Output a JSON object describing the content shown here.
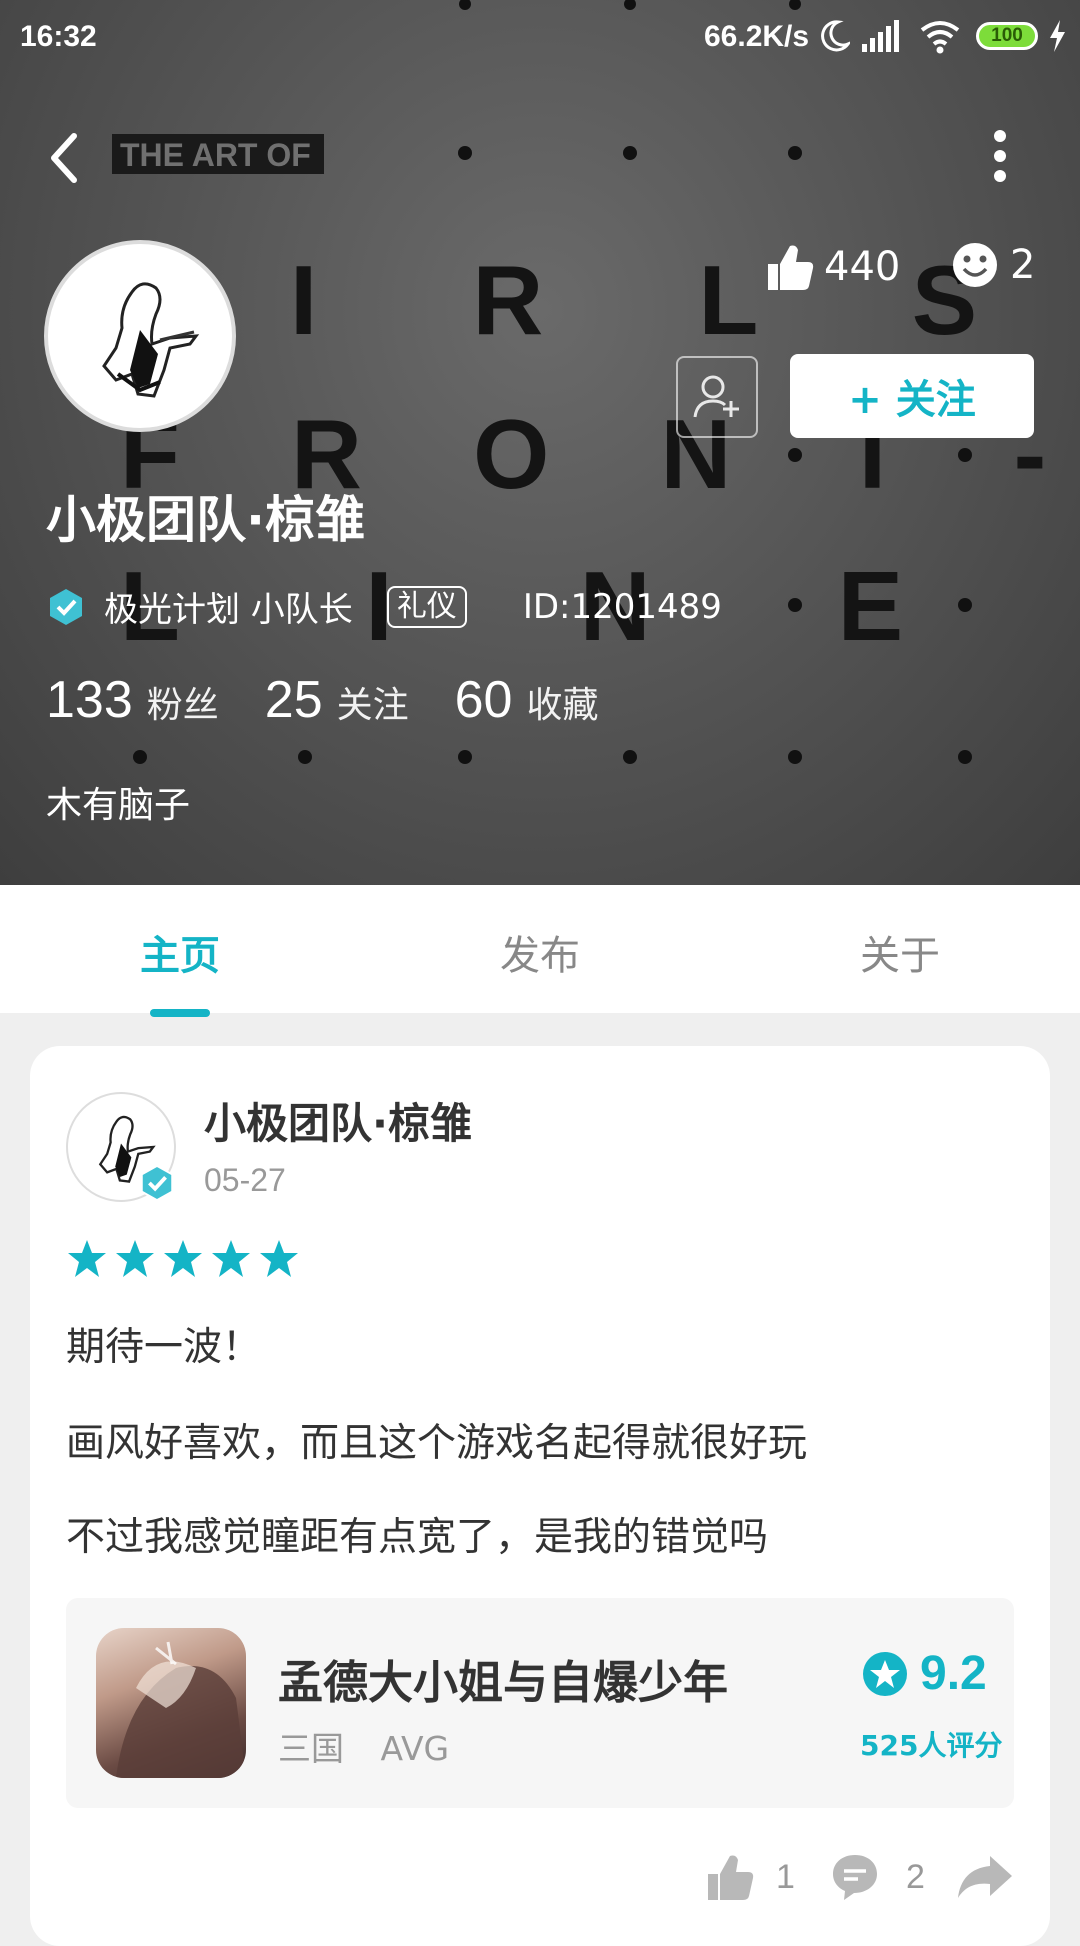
{
  "status_bar": {
    "time": "16:32",
    "net_speed": "66.2K/s",
    "battery": "100"
  },
  "header": {
    "likes": "440",
    "smiles": "2",
    "follow_label": "+ 关注",
    "name": "小极团队·椋雏",
    "badge_title": "极光计划 小队长",
    "etiquette_tag": "礼仪",
    "user_id": "ID:1201489",
    "stats": [
      {
        "value": "133",
        "label": "粉丝"
      },
      {
        "value": "25",
        "label": "关注"
      },
      {
        "value": "60",
        "label": "收藏"
      }
    ],
    "bio": "木有脑子",
    "background_text": {
      "top_label": "THE ART OF",
      "row1": "I R L S",
      "row2": "F R O N T -",
      "row3": "L I N E"
    }
  },
  "tabs": [
    {
      "label": "主页",
      "active": true
    },
    {
      "label": "发布",
      "active": false
    },
    {
      "label": "关于",
      "active": false
    }
  ],
  "post": {
    "author": "小极团队·椋雏",
    "date": "05-27",
    "rating": 5,
    "lines": [
      "期待一波！",
      "画风好喜欢，而且这个游戏名起得就很好玩",
      "不过我感觉瞳距有点宽了，是我的错觉吗"
    ],
    "game": {
      "title": "孟德大小姐与自爆少年",
      "tags": [
        "三国",
        "AVG"
      ],
      "score": "9.2",
      "rating_count": "525人评分"
    },
    "like_count": "1",
    "comment_count": "2"
  },
  "colors": {
    "accent": "#14b4c6",
    "page_bg": "#efefef"
  }
}
